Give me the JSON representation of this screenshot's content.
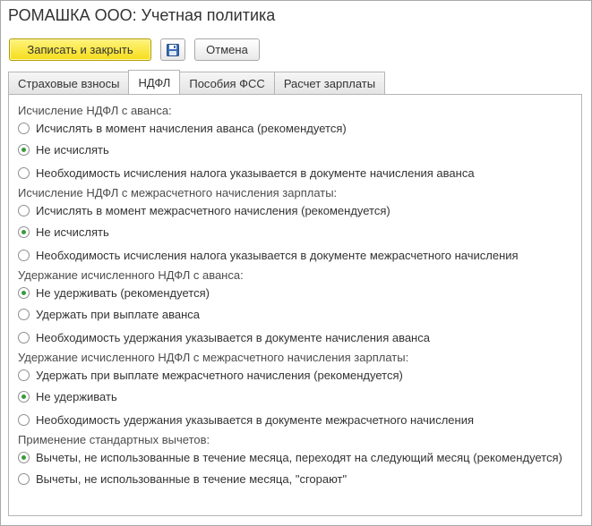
{
  "window": {
    "title": "РОМАШКА ООО: Учетная политика"
  },
  "toolbar": {
    "save_close_label": "Записать и закрыть",
    "cancel_label": "Отмена"
  },
  "tabs": [
    {
      "label": "Страховые взносы",
      "active": false
    },
    {
      "label": "НДФЛ",
      "active": true
    },
    {
      "label": "Пособия ФСС",
      "active": false
    },
    {
      "label": "Расчет зарплаты",
      "active": false
    }
  ],
  "groups": [
    {
      "label": "Исчисление НДФЛ с аванса:",
      "options": [
        {
          "label": "Исчислять в момент начисления аванса (рекомендуется)",
          "checked": false
        },
        {
          "label": "Не исчислять",
          "checked": true
        },
        {
          "label": "Необходимость исчисления налога указывается в документе начисления аванса",
          "checked": false
        }
      ]
    },
    {
      "label": "Исчисление НДФЛ с межрасчетного начисления зарплаты:",
      "options": [
        {
          "label": "Исчислять в момент межрасчетного начисления (рекомендуется)",
          "checked": false
        },
        {
          "label": "Не исчислять",
          "checked": true
        },
        {
          "label": "Необходимость исчисления налога указывается в документе межрасчетного начисления",
          "checked": false
        }
      ]
    },
    {
      "label": "Удержание исчисленного НДФЛ с аванса:",
      "options": [
        {
          "label": "Не удерживать (рекомендуется)",
          "checked": true
        },
        {
          "label": "Удержать при выплате аванса",
          "checked": false
        },
        {
          "label": "Необходимость удержания указывается в документе начисления аванса",
          "checked": false
        }
      ]
    },
    {
      "label": "Удержание исчисленного НДФЛ с межрасчетного начисления зарплаты:",
      "options": [
        {
          "label": "Удержать при выплате межрасчетного начисления (рекомендуется)",
          "checked": false
        },
        {
          "label": "Не удерживать",
          "checked": true
        },
        {
          "label": "Необходимость удержания указывается в документе межрасчетного начисления",
          "checked": false
        }
      ]
    },
    {
      "label": "Применение стандартных вычетов:",
      "options": [
        {
          "label": "Вычеты, не использованные в течение месяца, переходят на следующий месяц (рекомендуется)",
          "checked": true
        },
        {
          "label": "Вычеты, не использованные в течение месяца, \"сгорают\"",
          "checked": false
        }
      ]
    }
  ]
}
